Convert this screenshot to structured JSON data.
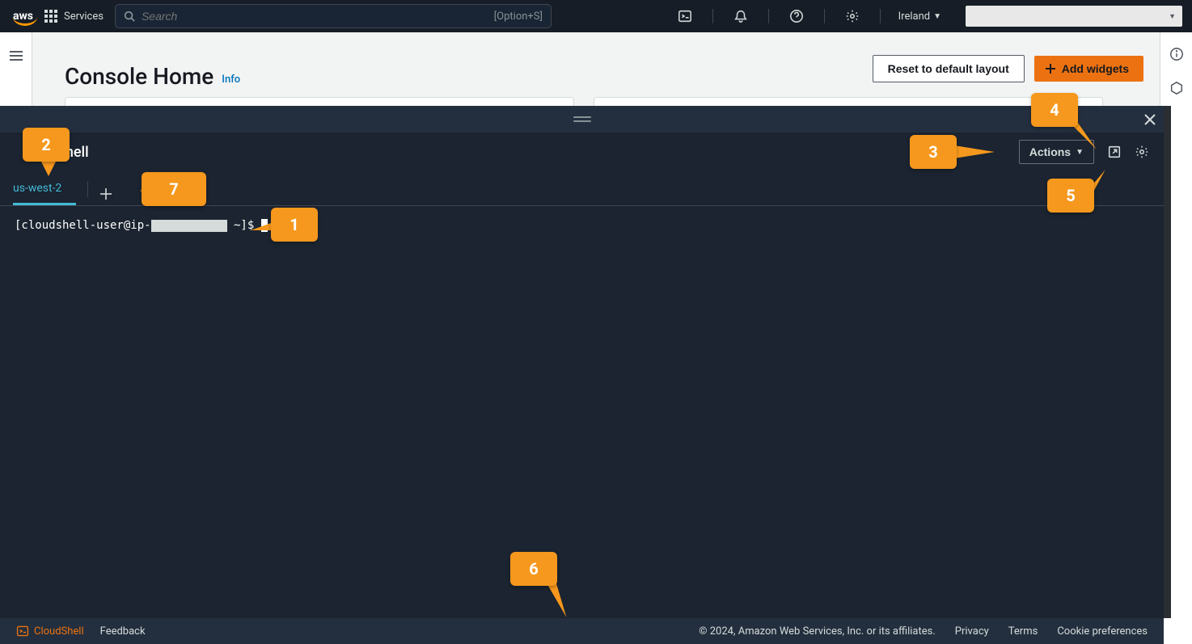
{
  "nav": {
    "logo": "aws",
    "services": "Services",
    "search_placeholder": "Search",
    "search_kbd": "[Option+S]",
    "region": "Ireland"
  },
  "home": {
    "title": "Console Home",
    "info": "Info",
    "reset": "Reset to default layout",
    "add": "Add widgets"
  },
  "cloudshell": {
    "title": "Shell",
    "actions": "Actions",
    "tab": "us-west-2",
    "prompt_pre": "[cloudshell-user@ip-",
    "prompt_post": " ~]$ "
  },
  "footer": {
    "cloudshell": "CloudShell",
    "feedback": "Feedback",
    "copyright": "© 2024, Amazon Web Services, Inc. or its affiliates.",
    "privacy": "Privacy",
    "terms": "Terms",
    "cookies": "Cookie preferences"
  },
  "callouts": {
    "1": "1",
    "2": "2",
    "3": "3",
    "4": "4",
    "5": "5",
    "6": "6",
    "7": "7"
  }
}
